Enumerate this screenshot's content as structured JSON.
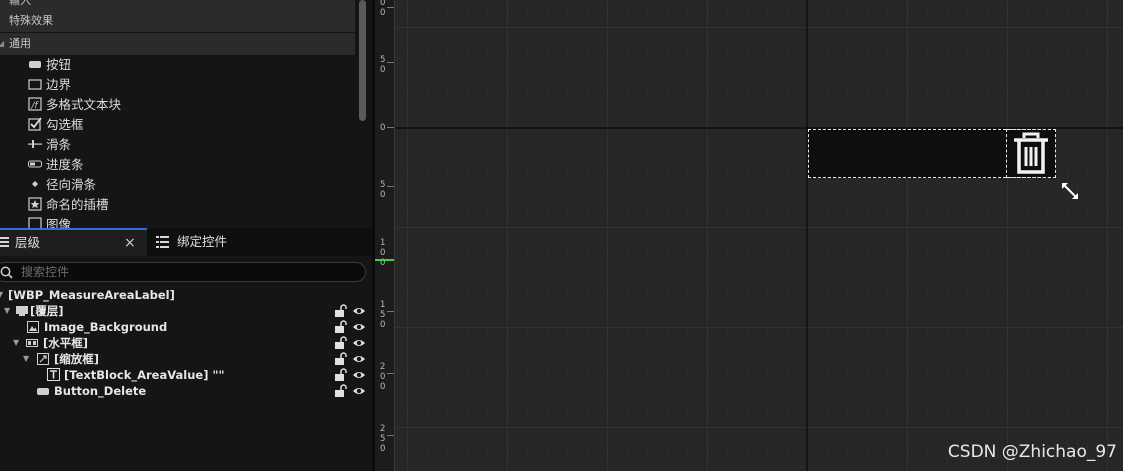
{
  "palette": {
    "categories": [
      "输入",
      "特殊效果",
      "通用"
    ],
    "items": [
      {
        "label": "按钮",
        "icon": "button-icon"
      },
      {
        "label": "边界",
        "icon": "border-icon"
      },
      {
        "label": "多格式文本块",
        "icon": "rich-text-icon"
      },
      {
        "label": "勾选框",
        "icon": "checkbox-icon"
      },
      {
        "label": "滑条",
        "icon": "slider-icon"
      },
      {
        "label": "进度条",
        "icon": "progress-bar-icon"
      },
      {
        "label": "径向滑条",
        "icon": "radial-slider-icon"
      },
      {
        "label": "命名的插槽",
        "icon": "named-slot-icon"
      },
      {
        "label": "图像",
        "icon": "image-icon"
      }
    ]
  },
  "tabs": {
    "hierarchy": "层级",
    "hierarchy_close": "×",
    "bindings": "绑定控件"
  },
  "search": {
    "placeholder": "搜索控件",
    "value": ""
  },
  "tree": [
    {
      "label": "[WBP_MeasureAreaLabel]",
      "icon": "none",
      "expanded": true
    },
    {
      "label": "[覆层]",
      "icon": "overlay-icon",
      "expanded": true
    },
    {
      "label": "Image_Background",
      "icon": "image-icon"
    },
    {
      "label": "[水平框]",
      "icon": "horizontal-box-icon",
      "expanded": true
    },
    {
      "label": "[缩放框]",
      "icon": "scale-box-icon",
      "expanded": true
    },
    {
      "label": "[TextBlock_AreaValue] \"\"",
      "icon": "text-icon"
    },
    {
      "label": "Button_Delete",
      "icon": "button-icon"
    }
  ],
  "ruler": {
    "labels": [
      "0",
      "5\n0",
      "0",
      "5\n0",
      "1\n0\n0",
      "1\n5\n0",
      "2\n0\n0",
      "2\n5\n0"
    ]
  },
  "canvas": {
    "delete_icon": "trash-icon",
    "resize_icon": "resize-arrows-icon"
  },
  "watermark": "CSDN @Zhichao_97",
  "colors": {
    "accent": "#2d6fd6",
    "canvas_bg": "#262626",
    "panel_bg": "#151515",
    "ruler_marker": "#3fd13f"
  }
}
